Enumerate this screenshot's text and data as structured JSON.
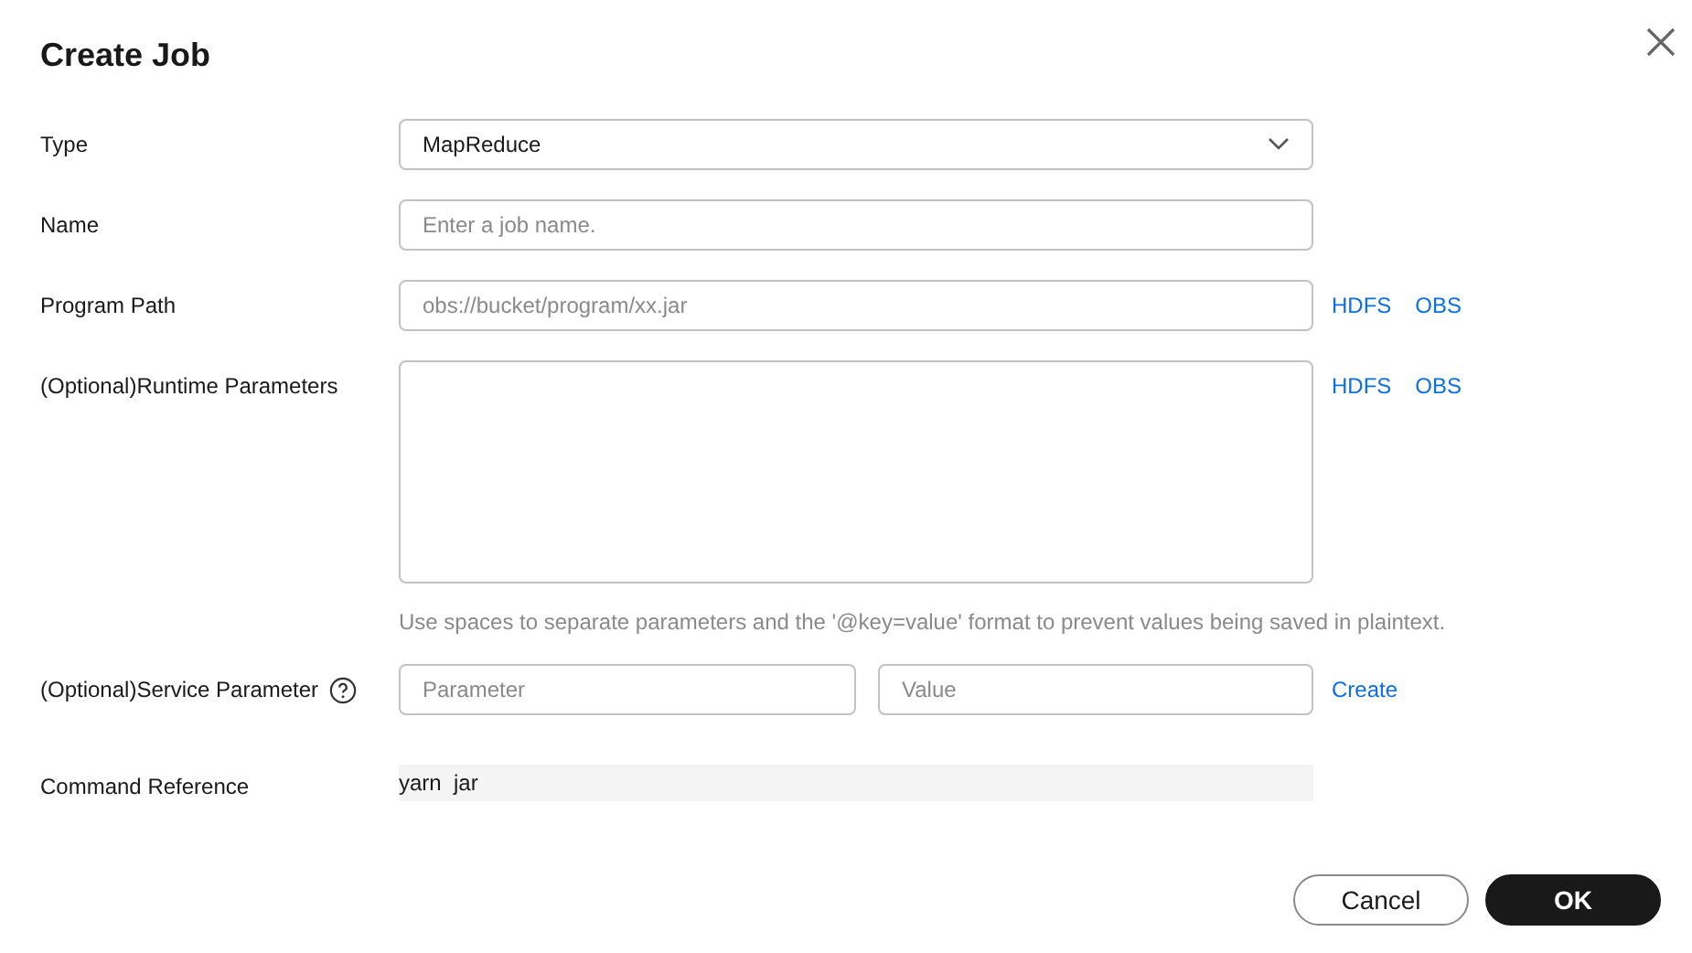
{
  "dialog": {
    "title": "Create Job"
  },
  "fields": [
    {
      "kind": "select",
      "label": "Type",
      "value": "MapReduce"
    },
    {
      "kind": "input",
      "label": "Name",
      "placeholder": "Enter a job name."
    },
    {
      "kind": "input",
      "label": "Program Path",
      "placeholder": "obs://bucket/program/xx.jar",
      "links": [
        "HDFS",
        "OBS"
      ]
    },
    {
      "kind": "textarea",
      "label": "(Optional)Runtime Parameters",
      "links": [
        "HDFS",
        "OBS"
      ],
      "hint": "Use spaces to separate parameters and the '@key=value' format to prevent values being saved in plaintext."
    },
    {
      "kind": "pair",
      "label": "(Optional)Service Parameter",
      "help": true,
      "placeholders": [
        "Parameter",
        "Value"
      ],
      "links": [
        "Create"
      ]
    },
    {
      "kind": "readonly",
      "label": "Command Reference",
      "value": "yarn  jar"
    }
  ],
  "buttons": [
    {
      "label": "Cancel",
      "primary": false
    },
    {
      "label": "OK",
      "primary": true
    }
  ]
}
